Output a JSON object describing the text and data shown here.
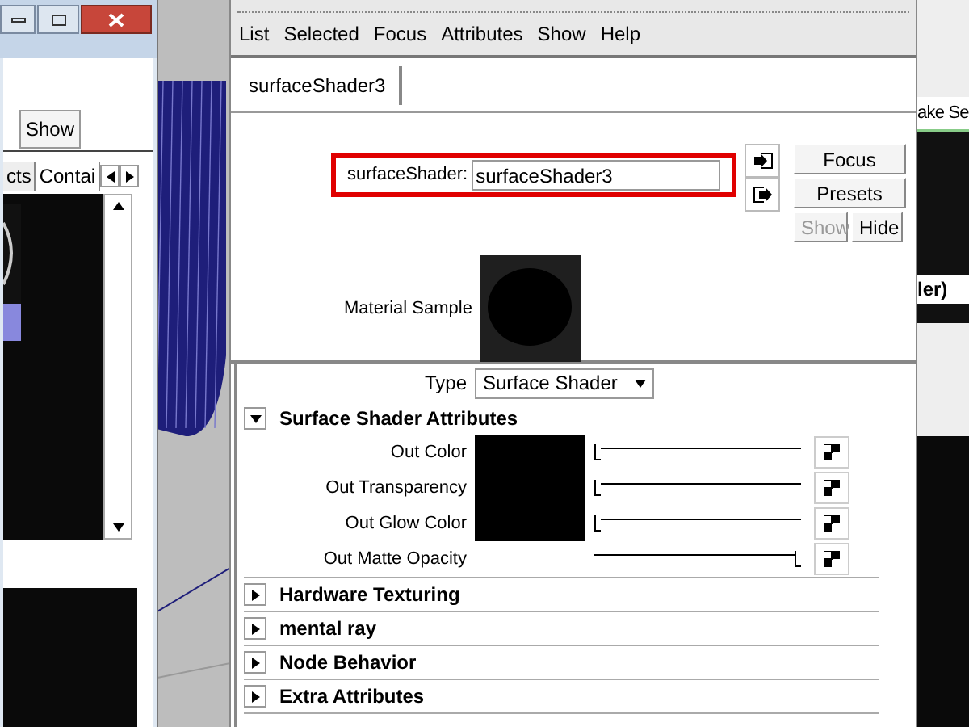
{
  "left_window": {
    "buttons": [
      "Show"
    ],
    "tabs": [
      {
        "label": "cts",
        "selected": false
      },
      {
        "label": "Contai",
        "selected": true
      }
    ]
  },
  "attribute_editor": {
    "menu": [
      "List",
      "Selected",
      "Focus",
      "Attributes",
      "Show",
      "Help"
    ],
    "tabs": [
      {
        "label": "surfaceShader3",
        "selected": true
      }
    ],
    "node_field": {
      "label": "surfaceShader:",
      "value": "surfaceShader3",
      "highlighted": true
    },
    "buttons": [
      {
        "label": "Focus",
        "disabled": false
      },
      {
        "label": "Presets",
        "disabled": false
      },
      {
        "label": "Show",
        "disabled": true
      },
      {
        "label": "Hide",
        "disabled": false
      }
    ],
    "material_sample": {
      "label": "Material Sample"
    },
    "type": {
      "label": "Type",
      "value": "Surface Shader"
    },
    "sections": [
      {
        "title": "Surface Shader Attributes",
        "expanded": true,
        "attributes": [
          {
            "label": "Out Color",
            "kind": "color",
            "color": "#000000",
            "level": 0
          },
          {
            "label": "Out Transparency",
            "kind": "color",
            "color": "#000000",
            "level": 0
          },
          {
            "label": "Out Glow Color",
            "kind": "color",
            "color": "#000000",
            "level": 0
          },
          {
            "label": "Out Matte Opacity",
            "kind": "slider",
            "level": 1
          }
        ]
      },
      {
        "title": "Hardware Texturing",
        "expanded": false
      },
      {
        "title": "mental ray",
        "expanded": false
      },
      {
        "title": "Node Behavior",
        "expanded": false
      },
      {
        "title": "Extra Attributes",
        "expanded": false
      }
    ]
  },
  "right_window": {
    "texts": [
      "ake Se",
      "ler)"
    ]
  }
}
